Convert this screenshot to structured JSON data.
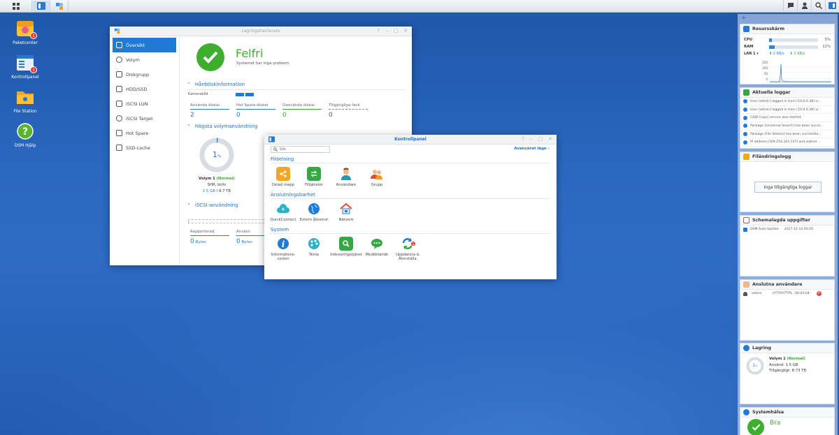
{
  "taskbar": {
    "left_icons": [
      "grid-icon",
      "control-panel-icon",
      "storage-manager-icon"
    ],
    "right_icons": [
      "chat-icon",
      "user-icon",
      "search-icon",
      "widgets-icon"
    ]
  },
  "desktop": {
    "icons": [
      {
        "label": "Paketcenter",
        "badge": "1"
      },
      {
        "label": "Kontrollpanel",
        "badge": "1"
      },
      {
        "label": "File Station"
      },
      {
        "label": "DSM Hjälp"
      }
    ]
  },
  "storage_manager": {
    "title": "Lagringshanterare",
    "nav": [
      "Översikt",
      "Volym",
      "Diskgrupp",
      "HDD/SSD",
      "iSCSI LUN",
      "iSCSI Target",
      "Hot Spare",
      "SSD-cache"
    ],
    "status_title": "Felfri",
    "status_text": "Systemet har inga problem.",
    "hdd_section": "Hårddiskinformation",
    "enclosure_label": "Kamerabild",
    "stats": [
      {
        "label": "Använda diskar",
        "value": "2"
      },
      {
        "label": "Hot Spare-diskar",
        "value": "0"
      },
      {
        "label": "Oanvända diskar",
        "value": "0"
      },
      {
        "label": "Tillgängliga fack",
        "value": "0"
      }
    ],
    "volume_section": "Högsta volymanvändning",
    "volume_pct": "1",
    "volume_pct_unit": "%",
    "volume_name": "Volym 1",
    "volume_status": "(Normal)",
    "volume_type": "SHR, btrfs",
    "volume_used": "1.5 GB",
    "volume_sep": " / ",
    "volume_total": "8.7 TB",
    "iscsi_section": "iSCSI-användning",
    "iscsi_stats": [
      {
        "label": "Rapporterad",
        "value": "0",
        "unit": "Bytes"
      },
      {
        "label": "Använt",
        "value": "0",
        "unit": "Bytes"
      }
    ]
  },
  "control_panel": {
    "title": "Kontrollpanel",
    "search_placeholder": "Sök",
    "advanced_mode": "Avancerat läge",
    "sections": [
      {
        "title": "Fildelning",
        "items": [
          "Delad mapp",
          "Filtjänster",
          "Användare",
          "Grupp"
        ]
      },
      {
        "title": "Anslutningsbarhet",
        "items": [
          "QuickConnect",
          "Extern åtkomst",
          "Nätverk"
        ]
      },
      {
        "title": "System",
        "items": [
          "Informations-center",
          "Tema",
          "Indexeringstjänst",
          "Meddelande",
          "Uppdatera & Återställa"
        ]
      }
    ],
    "update_badge": "1"
  },
  "widgets": {
    "resource": {
      "title": "Resursskärm",
      "cpu_label": "CPU",
      "cpu_pct": "5%",
      "ram_label": "RAM",
      "ram_pct": "11%",
      "lan_label": "LAN 1",
      "lan_up": "2 KB/s",
      "lan_down": "2 KB/s",
      "chart_ticks": [
        "150",
        "100",
        "50",
        "0"
      ]
    },
    "logs": {
      "title": "Aktuella loggar",
      "rows": [
        "User [admin] logged in from [10.0.0.38] vi...",
        "User [admin] logged in from [10.0.0.38] vi...",
        "[USB Copy] service was started.",
        "Package [Universal Search] has been succe...",
        "Package [File Station] has been successful...",
        "IP address [169.254.163.137] and subnet ..."
      ]
    },
    "file_change": {
      "title": "Filändringslogg",
      "empty_button": "Inga tillgängliga loggar"
    },
    "scheduled": {
      "title": "Schemalagda uppgifter",
      "task": "DSM Auto Update",
      "time": "2017-12-14 00:20"
    },
    "connected": {
      "title": "Anslutna användare",
      "user": "admin",
      "protocol": "HTTP/HTTPS",
      "duration": "00:03:04"
    },
    "storage": {
      "title": "Lagring",
      "volume": "Volym 1",
      "status": "(Normal)",
      "used_label": "Använd:",
      "used": "1.5 GB",
      "avail_label": "Tillgängligt:",
      "avail": "8.73 TB",
      "pct": "1",
      "pct_unit": "%"
    },
    "health": {
      "title": "Systemhälsa",
      "status": "Bra"
    }
  },
  "colors": {
    "accent": "#1f7bd6",
    "ok": "#3eae2f",
    "desktop": "#2b68bf"
  }
}
